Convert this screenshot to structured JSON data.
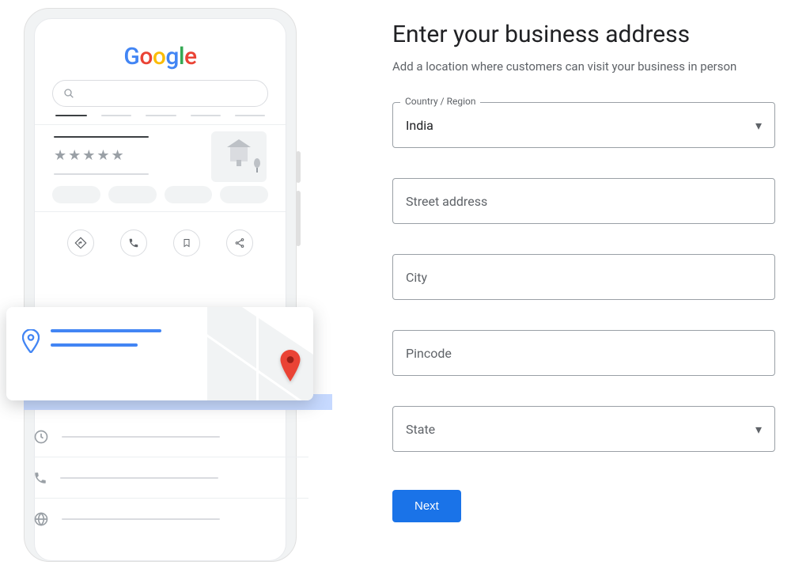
{
  "heading": "Enter your business address",
  "subheading": "Add a location where customers can visit your business in person",
  "country_label": "Country / Region",
  "country_value": "India",
  "street_placeholder": "Street address",
  "city_placeholder": "City",
  "pin_placeholder": "Pincode",
  "state_placeholder": "State",
  "next_label": "Next"
}
